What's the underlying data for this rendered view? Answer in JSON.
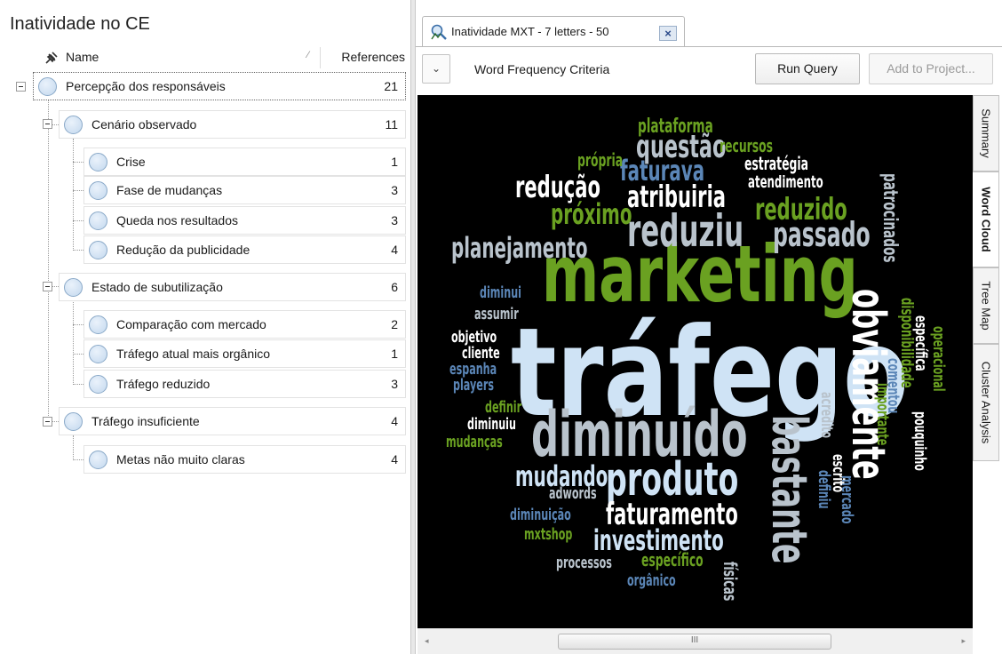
{
  "left_panel": {
    "title": "Inatividade no CE",
    "columns": {
      "name": "Name",
      "references": "References"
    },
    "nodes": [
      {
        "label": "Percepção dos responsáveis",
        "refs": "21"
      },
      {
        "label": "Cenário observado",
        "refs": "11"
      },
      {
        "label": "Crise",
        "refs": "1"
      },
      {
        "label": "Fase de mudanças",
        "refs": "3"
      },
      {
        "label": "Queda nos resultados",
        "refs": "3"
      },
      {
        "label": "Redução da publicidade",
        "refs": "4"
      },
      {
        "label": "Estado de subutilização",
        "refs": "6"
      },
      {
        "label": "Comparação com mercado",
        "refs": "2"
      },
      {
        "label": "Tráfego atual mais orgânico",
        "refs": "1"
      },
      {
        "label": "Tráfego reduzido",
        "refs": "3"
      },
      {
        "label": "Tráfego insuficiente",
        "refs": "4"
      },
      {
        "label": "Metas não muito claras",
        "refs": "4"
      }
    ]
  },
  "right_panel": {
    "tab_title": "Inatividade MXT - 7 letters - 50",
    "tab_close": "×",
    "criteria_toggle": "⌄",
    "criteria_label": "Word Frequency Criteria",
    "run_query_label": "Run Query",
    "add_to_project_label": "Add to Project...",
    "side_tabs": [
      "Summary",
      "Word Cloud",
      "Tree Map",
      "Cluster Analysis"
    ],
    "active_side_tab": "Word Cloud",
    "scroll_grip": "III",
    "scroll_left": "◂",
    "scroll_right": "▸"
  },
  "colors": {
    "cloud_background": "#000000",
    "word_white": "#ffffff",
    "word_lightblue": "#cfe3f5",
    "word_gray": "#b9c3cc",
    "word_green": "#6aa121",
    "word_blue": "#5b86b7",
    "word_darkgray": "#9a9a9a"
  },
  "word_cloud": [
    "tráfego",
    "marketing",
    "diminuído",
    "obviamente",
    "bastante",
    "produto",
    "reduziu",
    "passado",
    "planejamento",
    "redução",
    "faturava",
    "questão",
    "atribuiria",
    "reduzido",
    "próximo",
    "faturamento",
    "investimento",
    "mudando",
    "plataforma",
    "recursos",
    "própria",
    "estratégia",
    "atendimento",
    "patrocinados",
    "diminui",
    "assumir",
    "objetivo",
    "cliente",
    "espanha",
    "players",
    "definir",
    "diminuiu",
    "mudanças",
    "adwords",
    "diminuição",
    "mxtshop",
    "processos",
    "específico",
    "orgânico",
    "físicas",
    "mercado",
    "definiu",
    "escrito",
    "acredito",
    "importante",
    "comentou",
    "disponibilidade",
    "específica",
    "operacional",
    "pouquinho"
  ]
}
